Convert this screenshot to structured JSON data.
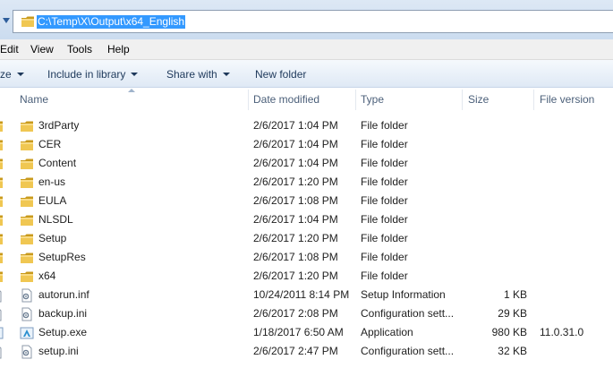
{
  "address": {
    "path": "C:\\Temp\\X\\Output\\x64_English"
  },
  "menu": {
    "items": [
      "Edit",
      "View",
      "Tools",
      "Help"
    ]
  },
  "toolbar": {
    "organize_label": "ze",
    "include_label": "Include in library",
    "share_label": "Share with",
    "new_folder_label": "New folder"
  },
  "columns": {
    "name": "Name",
    "date": "Date modified",
    "type": "Type",
    "size": "Size",
    "version": "File version"
  },
  "files": [
    {
      "name": "3rdParty",
      "date": "2/6/2017 1:04 PM",
      "type": "File folder",
      "size": "",
      "version": "",
      "icon": "folder-icon"
    },
    {
      "name": "CER",
      "date": "2/6/2017 1:04 PM",
      "type": "File folder",
      "size": "",
      "version": "",
      "icon": "folder-icon"
    },
    {
      "name": "Content",
      "date": "2/6/2017 1:04 PM",
      "type": "File folder",
      "size": "",
      "version": "",
      "icon": "folder-icon"
    },
    {
      "name": "en-us",
      "date": "2/6/2017 1:20 PM",
      "type": "File folder",
      "size": "",
      "version": "",
      "icon": "folder-icon"
    },
    {
      "name": "EULA",
      "date": "2/6/2017 1:08 PM",
      "type": "File folder",
      "size": "",
      "version": "",
      "icon": "folder-icon"
    },
    {
      "name": "NLSDL",
      "date": "2/6/2017 1:04 PM",
      "type": "File folder",
      "size": "",
      "version": "",
      "icon": "folder-icon"
    },
    {
      "name": "Setup",
      "date": "2/6/2017 1:20 PM",
      "type": "File folder",
      "size": "",
      "version": "",
      "icon": "folder-icon"
    },
    {
      "name": "SetupRes",
      "date": "2/6/2017 1:08 PM",
      "type": "File folder",
      "size": "",
      "version": "",
      "icon": "folder-icon"
    },
    {
      "name": "x64",
      "date": "2/6/2017 1:20 PM",
      "type": "File folder",
      "size": "",
      "version": "",
      "icon": "folder-icon"
    },
    {
      "name": "autorun.inf",
      "date": "10/24/2011 8:14 PM",
      "type": "Setup Information",
      "size": "1 KB",
      "version": "",
      "icon": "settings-file-icon"
    },
    {
      "name": "backup.ini",
      "date": "2/6/2017 2:08 PM",
      "type": "Configuration sett...",
      "size": "29 KB",
      "version": "",
      "icon": "settings-file-icon"
    },
    {
      "name": "Setup.exe",
      "date": "1/18/2017 6:50 AM",
      "type": "Application",
      "size": "980 KB",
      "version": "11.0.31.0",
      "icon": "application-icon"
    },
    {
      "name": "setup.ini",
      "date": "2/6/2017 2:47 PM",
      "type": "Configuration sett...",
      "size": "32 KB",
      "version": "",
      "icon": "settings-file-icon"
    }
  ],
  "colors": {
    "folder": "#e8b830",
    "selection": "#3399ff",
    "header_text": "#4c607a",
    "command_text": "#1e395b"
  }
}
